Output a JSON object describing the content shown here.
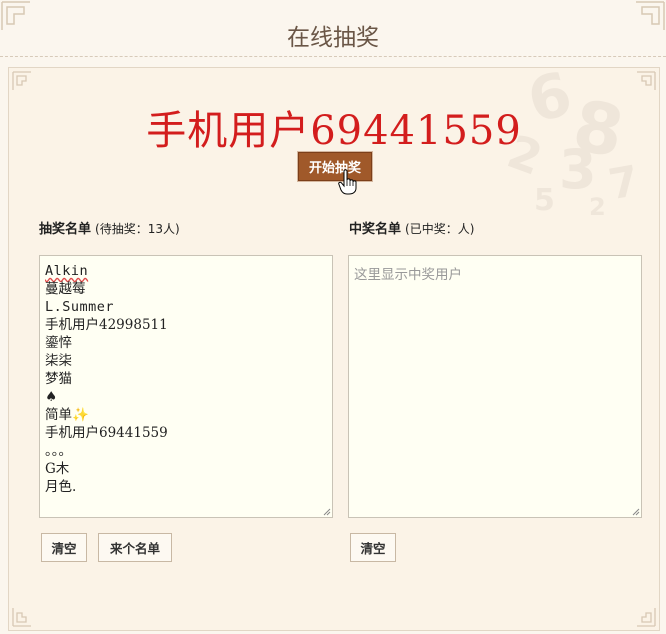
{
  "header": {
    "title": "在线抽奖"
  },
  "winner_display": "手机用户69441559",
  "start_button": "开始抽奖",
  "left": {
    "label": "抽奖名单",
    "sublabel": "(待抽奖：13人)",
    "entries": [
      "Alkin",
      "蔓越莓",
      "L.Summer",
      "手机用户42998511",
      "鎏悴",
      "柒柒",
      "梦猫",
      "♠",
      "简单✨",
      "手机用户69441559",
      "。。。",
      "G木",
      "月色."
    ],
    "clear_button": "清空",
    "load_button": "来个名单"
  },
  "right": {
    "label": "中奖名单",
    "sublabel": "(已中奖：人)",
    "placeholder": "这里显示中奖用户",
    "clear_button": "清空"
  },
  "colors": {
    "accent": "#a0592a",
    "winner": "#d31d1d",
    "title": "#6a5646"
  }
}
